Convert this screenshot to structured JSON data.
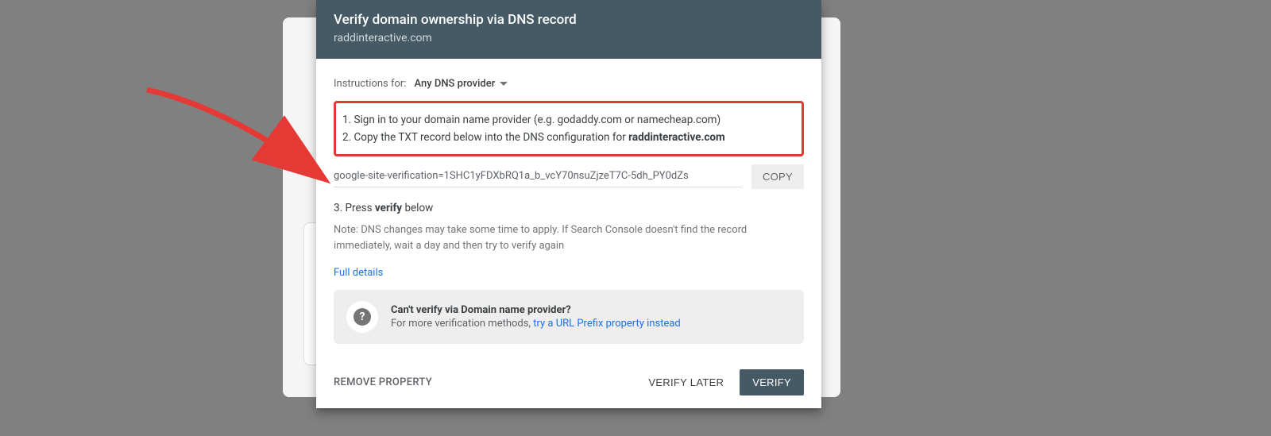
{
  "header": {
    "title": "Verify domain ownership via DNS record",
    "domain": "raddinteractive.com"
  },
  "instructions": {
    "label": "Instructions for:",
    "provider_selected": "Any DNS provider",
    "step1_prefix": "1. ",
    "step1_text": "Sign in to your domain name provider (e.g. godaddy.com or namecheap.com)",
    "step2_prefix": "2. ",
    "step2_text": "Copy the TXT record below into the DNS configuration for ",
    "step2_bold": "raddinteractive.com",
    "txt_record": "google-site-verification=1SHC1yFDXbRQ1a_b_vcY70nsuZjzeT7C-5dh_PY0dZs",
    "copy_label": "COPY",
    "step3_prefix": "3. Press ",
    "step3_bold": "verify",
    "step3_suffix": " below",
    "note": "Note: DNS changes may take some time to apply. If Search Console doesn't find the record immediately, wait a day and then try to verify again",
    "full_details": "Full details"
  },
  "help": {
    "title": "Can't verify via Domain name provider?",
    "text_prefix": "For more verification methods, ",
    "link": "try a URL Prefix property instead"
  },
  "actions": {
    "remove": "REMOVE PROPERTY",
    "later": "VERIFY LATER",
    "verify": "VERIFY"
  }
}
